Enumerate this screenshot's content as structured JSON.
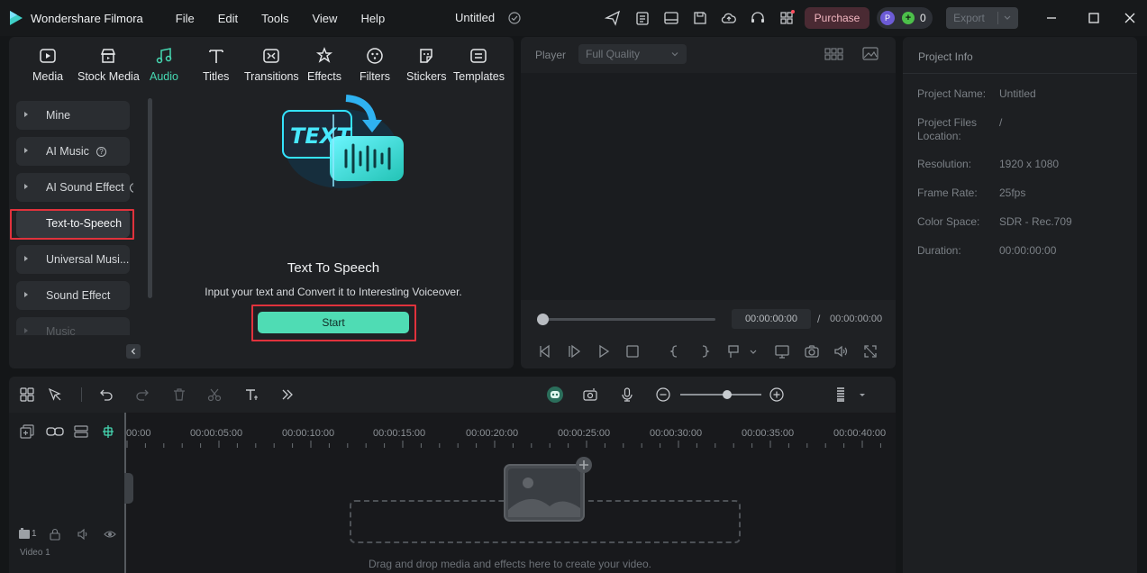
{
  "app": {
    "name": "Wondershare Filmora",
    "doc_title": "Untitled",
    "menu": [
      "File",
      "Edit",
      "Tools",
      "View",
      "Help"
    ],
    "purchase_label": "Purchase",
    "avatar_letter": "P",
    "credits": "0",
    "export_label": "Export"
  },
  "media_tabs": [
    {
      "label": "Media",
      "icon": "media-icon"
    },
    {
      "label": "Stock Media",
      "icon": "stock-media-icon"
    },
    {
      "label": "Audio",
      "icon": "audio-icon",
      "active": true
    },
    {
      "label": "Titles",
      "icon": "titles-icon"
    },
    {
      "label": "Transitions",
      "icon": "transitions-icon"
    },
    {
      "label": "Effects",
      "icon": "effects-icon"
    },
    {
      "label": "Filters",
      "icon": "filters-icon"
    },
    {
      "label": "Stickers",
      "icon": "stickers-icon"
    },
    {
      "label": "Templates",
      "icon": "templates-icon"
    }
  ],
  "sidebar": {
    "items": [
      {
        "label": "Mine"
      },
      {
        "label": "AI Music"
      },
      {
        "label": "AI Sound Effect"
      },
      {
        "label": "Text-to-Speech"
      },
      {
        "label": "Universal Musi..."
      },
      {
        "label": "Sound Effect"
      },
      {
        "label": "Music"
      }
    ]
  },
  "tts": {
    "art_text": "TEXT",
    "title": "Text To Speech",
    "subtitle": "Input your text and Convert it to Interesting Voiceover.",
    "start_label": "Start"
  },
  "player": {
    "label": "Player",
    "quality": "Full Quality",
    "time_current": "00:00:00:00",
    "time_sep": "/",
    "time_total": "00:00:00:00"
  },
  "project_info": {
    "title": "Project Info",
    "rows": [
      {
        "key": "Project Name:",
        "value": "Untitled"
      },
      {
        "key": "Project Files Location:",
        "value": "/"
      },
      {
        "key": "Resolution:",
        "value": "1920 x 1080"
      },
      {
        "key": "Frame Rate:",
        "value": "25fps"
      },
      {
        "key": "Color Space:",
        "value": "SDR - Rec.709"
      },
      {
        "key": "Duration:",
        "value": "00:00:00:00"
      }
    ]
  },
  "timeline": {
    "ruler": [
      "00:00",
      "00:00:05:00",
      "00:00:10:00",
      "00:00:15:00",
      "00:00:20:00",
      "00:00:25:00",
      "00:00:30:00",
      "00:00:35:00",
      "00:00:40:00"
    ],
    "track_label": "Video 1",
    "track_number": "1",
    "drop_hint": "Drag and drop media and effects here to create your video."
  },
  "colors": {
    "accent": "#46d8b2",
    "highlight": "#e0323c",
    "purchase_bg": "#4a2a33"
  }
}
